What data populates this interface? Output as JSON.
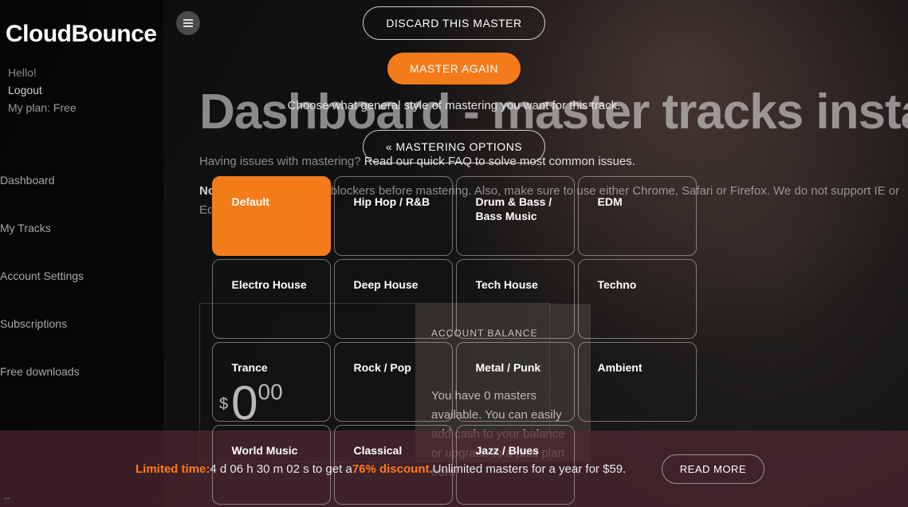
{
  "brand": "CloudBounce",
  "sidebar": {
    "hello": "Hello!",
    "logout": "Logout",
    "plan_prefix": "My plan: ",
    "plan": "Free",
    "items": [
      "Dashboard",
      "My Tracks",
      "Account Settings",
      "Subscriptions",
      "Free downloads"
    ]
  },
  "page": {
    "title": "Dashboard - master tracks instantly",
    "faq_prefix": "Having issues with mastering? ",
    "faq_link": "Read our quick FAQ to solve most common issues.",
    "note_bold": "Note:",
    "note_text": " Please turn off ad-blockers before mastering. Also, make sure to use either Chrome, Safari or Firefox. We do not support IE or Edge browser."
  },
  "balance": {
    "label": "ACCOUNT BALANCE",
    "currency": "$",
    "integer": "0",
    "cents": "00",
    "text": "You have 0 masters available. You can easily add cash to your balance or upgrade to a paid plan from"
  },
  "banner": {
    "limited": "Limited time:",
    "middle1": " 4 d 06 h 30 m 02 s  to get a ",
    "discount": "76% discount.",
    "middle2": " Unlimited masters for a year for $59.",
    "button": "READ MORE"
  },
  "modal": {
    "discard": "DISCARD THIS MASTER",
    "again": "MASTER AGAIN",
    "choose": "Choose what general style of mastering you want for this track.",
    "options": "« MASTERING OPTIONS",
    "tiles": [
      {
        "label": "Default",
        "selected": true
      },
      {
        "label": "Hip Hop / R&B",
        "selected": false
      },
      {
        "label": "Drum & Bass / Bass Music",
        "selected": false
      },
      {
        "label": "EDM",
        "selected": false
      },
      {
        "label": "Electro House",
        "selected": false
      },
      {
        "label": "Deep House",
        "selected": false
      },
      {
        "label": "Tech House",
        "selected": false
      },
      {
        "label": "Techno",
        "selected": false
      },
      {
        "label": "Trance",
        "selected": false
      },
      {
        "label": "Rock / Pop",
        "selected": false
      },
      {
        "label": "Metal / Punk",
        "selected": false
      },
      {
        "label": "Ambient",
        "selected": false
      },
      {
        "label": "World Music",
        "selected": false
      },
      {
        "label": "Classical",
        "selected": false
      },
      {
        "label": "Jazz / Blues",
        "selected": false
      }
    ]
  },
  "corner": "↔"
}
